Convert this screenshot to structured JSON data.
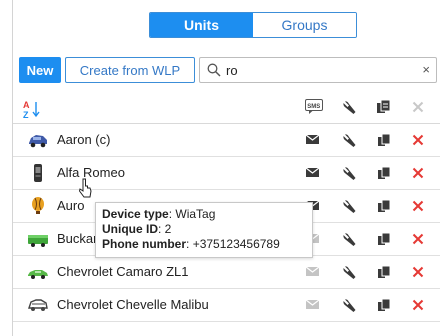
{
  "tabs": {
    "units": "Units",
    "groups": "Groups"
  },
  "toolbar": {
    "new_label": "New",
    "create_wlp_label": "Create from WLP",
    "search_value": "ro",
    "clear_symbol": "×"
  },
  "header": {
    "sort_icon": "sort-az-icon",
    "sms_label": "SMS"
  },
  "units": [
    {
      "name": "Aaron (c)",
      "icon": "car-blue-icon",
      "message_active": true
    },
    {
      "name": "Alfa Romeo",
      "icon": "tracker-device-icon",
      "message_active": true
    },
    {
      "name": "Auro",
      "icon": "balloon-icon",
      "message_active": true
    },
    {
      "name": "Buckaroo's rocket car",
      "icon": "green-truck-icon",
      "message_active": false
    },
    {
      "name": "Chevrolet Camaro ZL1",
      "icon": "green-car-icon",
      "message_active": false
    },
    {
      "name": "Chevrolet Chevelle Malibu",
      "icon": "grey-car-icon",
      "message_active": false
    }
  ],
  "tooltip": {
    "device_type_label": "Device type",
    "device_type_value": "WiaTag",
    "unique_id_label": "Unique ID",
    "unique_id_value": "2",
    "phone_label": "Phone number",
    "phone_value": "+375123456789"
  },
  "colors": {
    "accent": "#1d8ef0",
    "delete": "#e53935",
    "icon_dark": "#3a3a3a",
    "icon_light": "#bcbcbc"
  }
}
